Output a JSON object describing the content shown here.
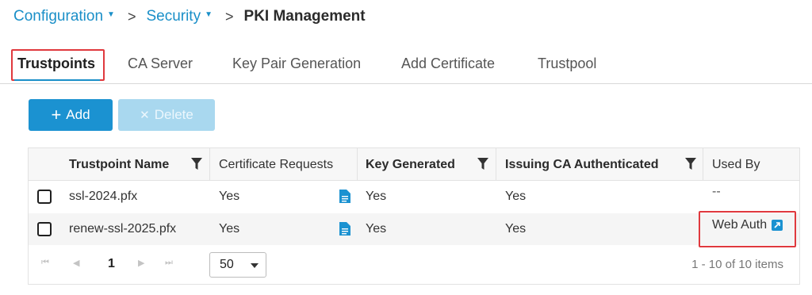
{
  "breadcrumb": {
    "items": [
      {
        "label": "Configuration"
      },
      {
        "label": "Security"
      }
    ],
    "separator": ">",
    "current": "PKI Management"
  },
  "tabs": [
    {
      "label": "Trustpoints",
      "active": true
    },
    {
      "label": "CA Server"
    },
    {
      "label": "Key Pair Generation"
    },
    {
      "label": "Add Certificate"
    },
    {
      "label": "Trustpool"
    }
  ],
  "toolbar": {
    "add_icon": "+",
    "add_label": "Add",
    "delete_icon": "✕",
    "delete_label": "Delete"
  },
  "table": {
    "columns": [
      {
        "label": "Trustpoint Name",
        "filter": true
      },
      {
        "label": "Certificate Requests",
        "filter": false
      },
      {
        "label": "Key Generated",
        "filter": true
      },
      {
        "label": "Issuing CA Authenticated",
        "filter": true
      },
      {
        "label": "Used By",
        "filter": false
      }
    ],
    "rows": [
      {
        "name": "ssl-2024.pfx",
        "cert_requests": "Yes",
        "key_generated": "Yes",
        "ca_authenticated": "Yes",
        "used_by": "--"
      },
      {
        "name": "renew-ssl-2025.pfx",
        "cert_requests": "Yes",
        "key_generated": "Yes",
        "ca_authenticated": "Yes",
        "used_by": "Web Auth"
      }
    ]
  },
  "pager": {
    "first": "⏮",
    "prev": "◀",
    "page": "1",
    "next": "▶",
    "last": "⏭",
    "page_size": "50",
    "info": "1 - 10 of 10 items"
  },
  "colors": {
    "accent": "#1b92d1",
    "highlight": "#e0393e"
  }
}
